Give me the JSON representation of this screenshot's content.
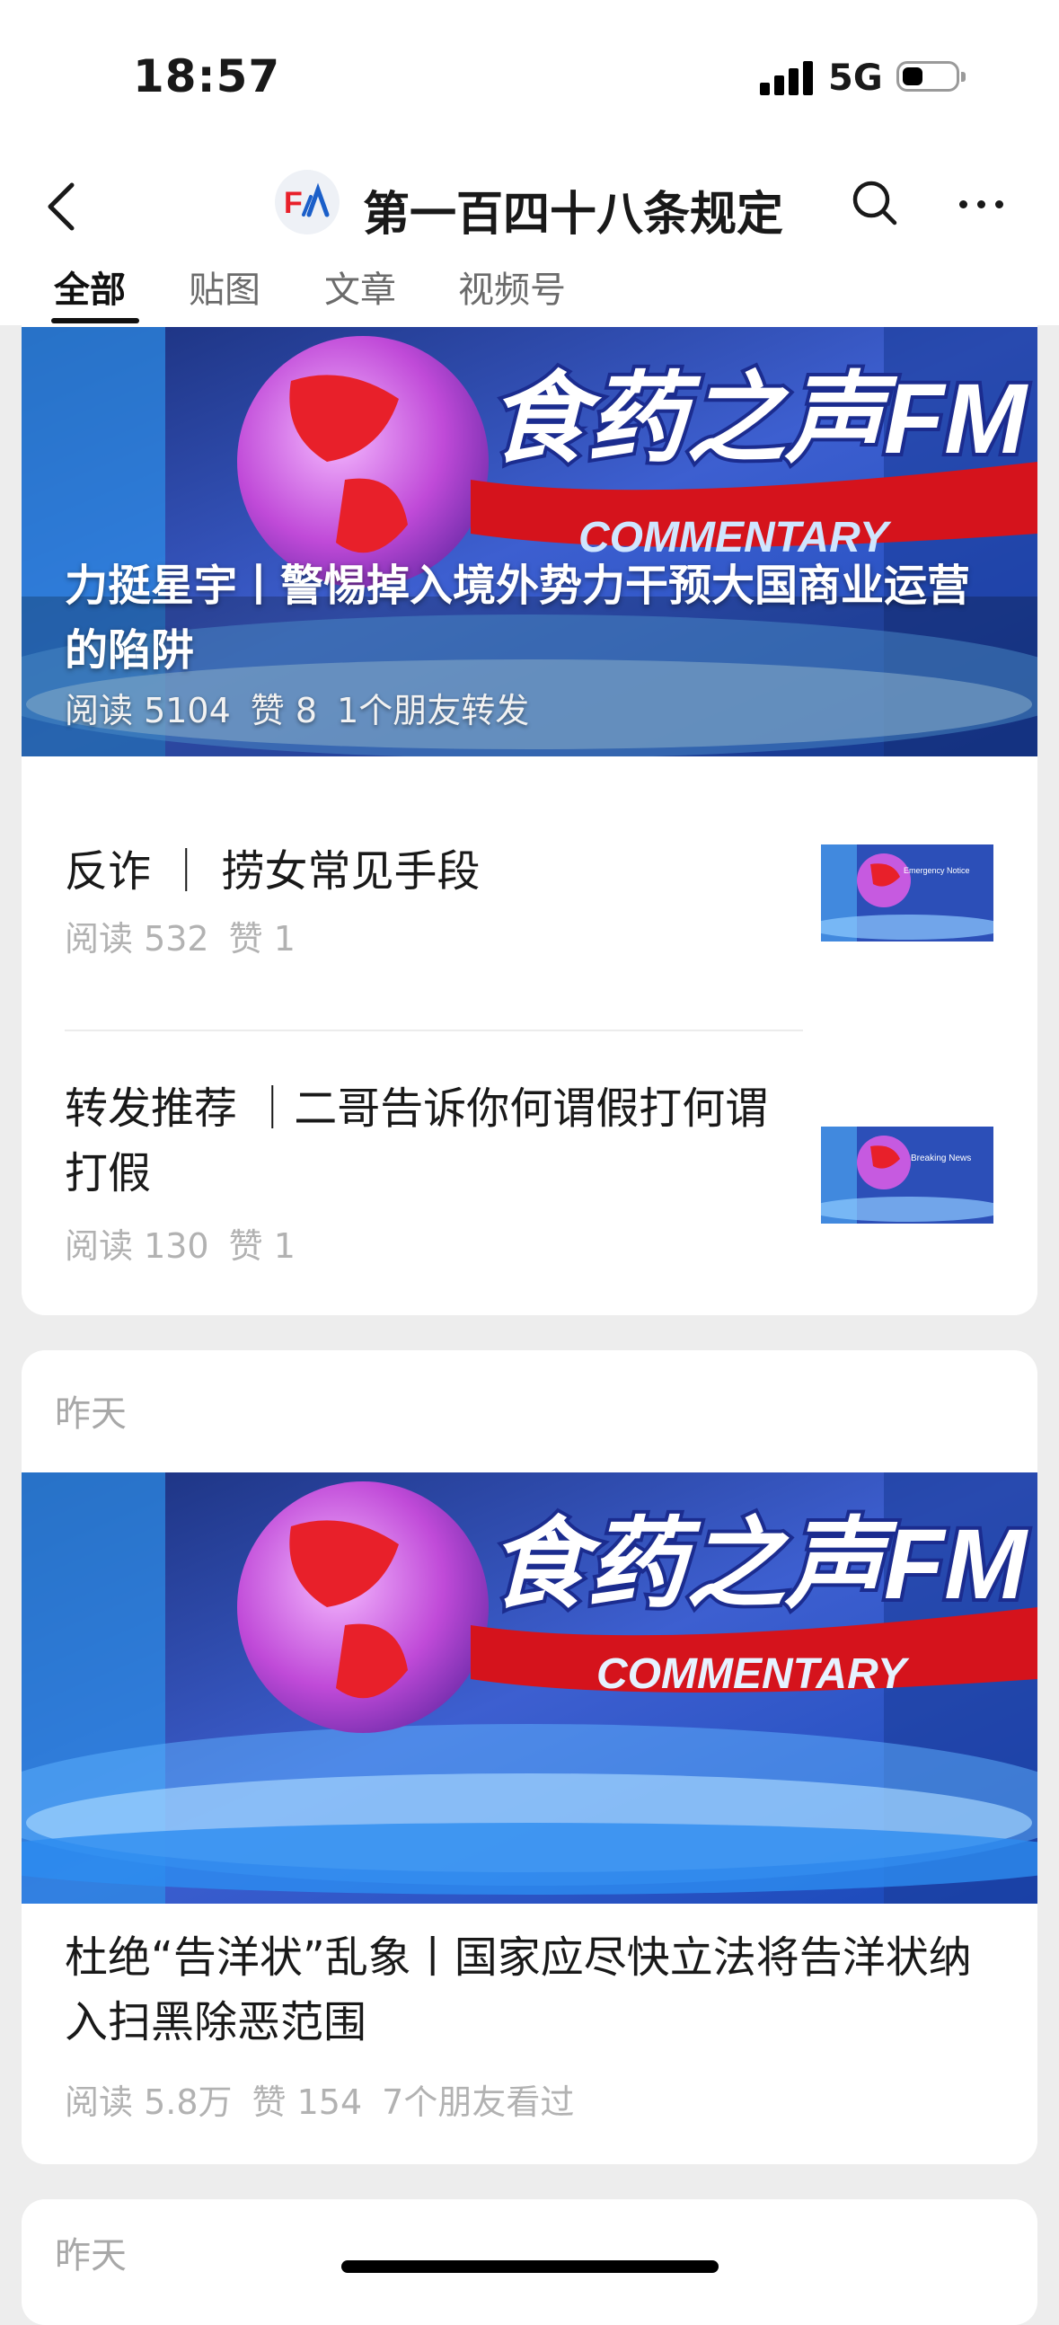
{
  "status_bar": {
    "time": "18:57",
    "network": "5G"
  },
  "header": {
    "account_name": "第一百四十八条规定",
    "logo_text": "F"
  },
  "tabs": [
    {
      "label": "全部",
      "active": true
    },
    {
      "label": "贴图",
      "active": false
    },
    {
      "label": "文章",
      "active": false
    },
    {
      "label": "视频号",
      "active": false
    }
  ],
  "cover_texts": {
    "brand": "食药之声FM",
    "commentary": "COMMENTARY",
    "thumb1": "Emergency Notice",
    "thumb2": "Breaking News"
  },
  "feed": {
    "group1": {
      "featured": {
        "title": "力挺星宇丨警惕掉入境外势力干预大国商业运营的陷阱",
        "reads": "阅读 5104",
        "likes": "赞 8",
        "friends": "1个朋友转发"
      },
      "items": [
        {
          "title": "反诈 ｜ 捞女常见手段",
          "reads": "阅读 532",
          "likes": "赞 1"
        },
        {
          "title": "转发推荐 ｜二哥告诉你何谓假打何谓打假",
          "reads": "阅读 130",
          "likes": "赞 1"
        }
      ]
    },
    "group2": {
      "date": "昨天",
      "featured": {
        "title": "杜绝“告洋状”乱象丨国家应尽快立法将告洋状纳入扫黑除恶范围",
        "reads": "阅读 5.8万",
        "likes": "赞 154",
        "friends": "7个朋友看过"
      }
    },
    "group3": {
      "date": "昨天"
    }
  },
  "colors": {
    "background": "#ededed",
    "card": "#ffffff",
    "meta_gray": "#b2b2b2",
    "accent_red": "#e8202a",
    "studio_blue": "#1b6fd0"
  }
}
